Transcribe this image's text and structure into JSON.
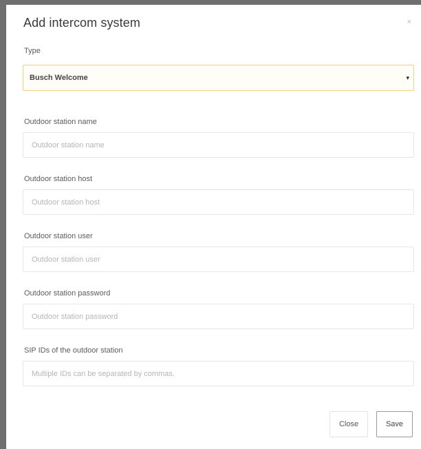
{
  "dialog": {
    "title": "Add intercom system",
    "close_glyph": "×"
  },
  "type_field": {
    "label": "Type",
    "value": "Busch Welcome",
    "caret": "▾"
  },
  "fields": [
    {
      "label": "Outdoor station name",
      "placeholder": "Outdoor station name"
    },
    {
      "label": "Outdoor station host",
      "placeholder": "Outdoor station host"
    },
    {
      "label": "Outdoor station user",
      "placeholder": "Outdoor station user"
    },
    {
      "label": "Outdoor station password",
      "placeholder": "Outdoor station password"
    },
    {
      "label": "SIP IDs of the outdoor station",
      "placeholder": "Multiple IDs can be separated by commas."
    }
  ],
  "buttons": {
    "close_label": "Close",
    "save_label": "Save"
  },
  "colors": {
    "backdrop": "#6f6f6f",
    "select_focus_border": "#f0cf86",
    "input_border": "#e6e6e6"
  }
}
